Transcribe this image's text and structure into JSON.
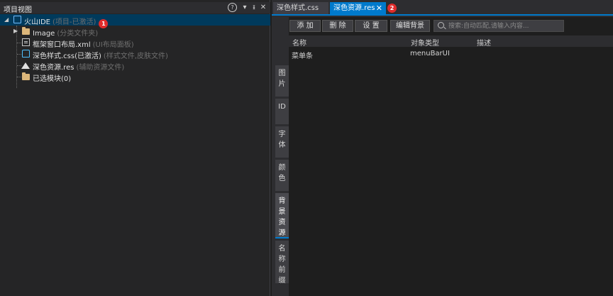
{
  "left_panel": {
    "title": "项目视图",
    "controls": {
      "help": "?",
      "menu": "▾",
      "pin": "ᵻ",
      "close": "✕"
    },
    "tree": [
      {
        "label": "火山IDE",
        "note": "(项目-已激活)",
        "badge": "1",
        "icon": "monitor-icon",
        "selected": true
      },
      {
        "label": "Image",
        "note": "(分类文件夹)",
        "icon": "folder-icon"
      },
      {
        "label": "框架窗口布局.xml",
        "note": "(UI布局面板)",
        "icon": "document-icon"
      },
      {
        "label": "深色样式.css(已激活)",
        "note": "(样式文件,皮肤文件)",
        "icon": "shirt-icon"
      },
      {
        "label": "深色资源.res",
        "note": "(辅助资源文件)",
        "icon": "mountain-icon"
      },
      {
        "label": "已选模块(0)",
        "note": "",
        "icon": "folder-icon"
      }
    ]
  },
  "right_panel": {
    "tabs": [
      {
        "label": "深色样式.css",
        "active": false
      },
      {
        "label": "深色资源.res",
        "active": true,
        "close": "✕"
      }
    ],
    "tab_badge": "2",
    "toolbar": {
      "add": "添 加",
      "delete": "删 除",
      "settings": "设 置",
      "edit_background": "编辑背景"
    },
    "search": {
      "placeholder": "搜索:自动匹配,请输入内容..."
    },
    "table": {
      "columns": [
        "名称",
        "对象类型",
        "描述"
      ],
      "rows": [
        {
          "name": "菜单条",
          "type": "menuBarUI",
          "desc": ""
        }
      ]
    },
    "side_tabs": [
      "图片",
      "ID",
      "字体",
      "颜色",
      "背景资源",
      "名称前缀"
    ],
    "active_side_tab": "背景资源"
  },
  "colors": {
    "accent": "#007acc",
    "badge": "#e02b2b",
    "selected_row": "#003a5c"
  }
}
